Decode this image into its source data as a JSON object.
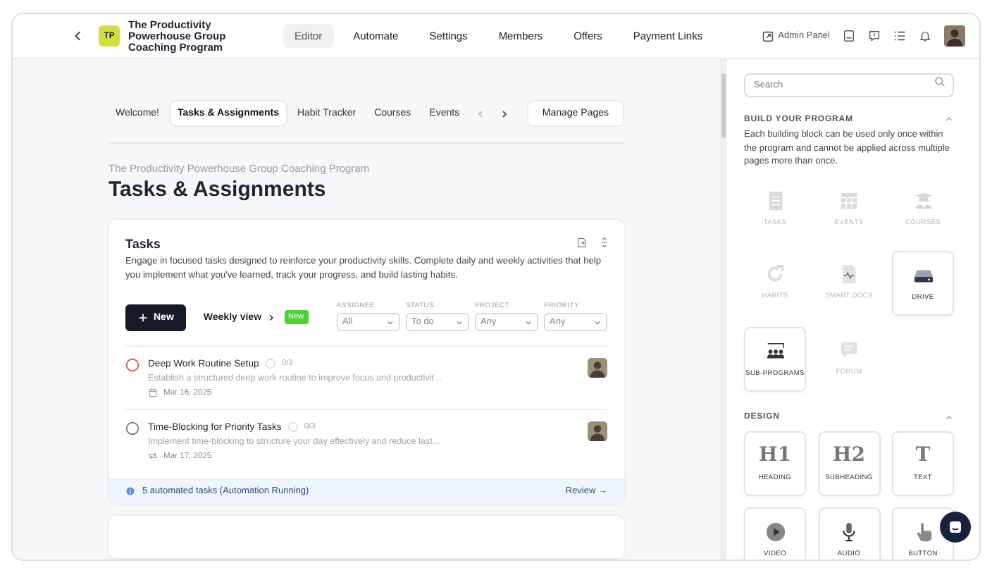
{
  "header": {
    "logo": "TP",
    "program_name": "The Productivity Powerhouse Group Coaching Program",
    "nav": [
      {
        "label": "Editor",
        "selected": true
      },
      {
        "label": "Automate",
        "selected": false
      },
      {
        "label": "Settings",
        "selected": false
      },
      {
        "label": "Members",
        "selected": false
      },
      {
        "label": "Offers",
        "selected": false
      },
      {
        "label": "Payment Links",
        "selected": false
      }
    ],
    "admin_panel": "Admin Panel"
  },
  "page_tabs": [
    {
      "label": "Welcome!",
      "selected": false
    },
    {
      "label": "Tasks & Assignments",
      "selected": true
    },
    {
      "label": "Habit Tracker",
      "selected": false
    },
    {
      "label": "Courses",
      "selected": false
    },
    {
      "label": "Events",
      "selected": false
    }
  ],
  "manage_pages": "Manage Pages",
  "breadcrumb": "The Productivity Powerhouse Group Coaching Program",
  "title": "Tasks & Assignments",
  "tasks_card": {
    "title": "Tasks",
    "description": "Engage in focused tasks designed to reinforce your productivity skills. Complete daily and weekly activities that help you implement what you've learned, track your progress, and build lasting habits.",
    "new_button": "New",
    "weekly_view": "Weekly view",
    "new_badge": "New",
    "filters": [
      {
        "label": "ASSIGNEE",
        "value": "All"
      },
      {
        "label": "STATUS",
        "value": "To do"
      },
      {
        "label": "PROJECT",
        "value": "Any"
      },
      {
        "label": "PRIORITY",
        "value": "Any"
      }
    ],
    "tasks": [
      {
        "title": "Deep Work Routine Setup",
        "progress": "0/3",
        "description": "Establish a structured deep work routine to improve focus and productivit...",
        "date": "Mar 16, 2025",
        "kind": "calendar",
        "color": "#e5484d"
      },
      {
        "title": "Time-Blocking for Priority Tasks",
        "progress": "0/3",
        "description": "Implement time-blocking to structure your day effectively and reduce last...",
        "date": "Mar 17, 2025",
        "kind": "repeat",
        "color": "#6b7280"
      }
    ],
    "automation": {
      "text": "5 automated tasks (Automation Running)",
      "link": "Review →"
    }
  },
  "sidebar": {
    "search_placeholder": "Search",
    "sections": [
      {
        "title": "BUILD YOUR PROGRAM",
        "expanded": true,
        "description": "Each building block can be used only once within the program and cannot be applied across multiple pages more than once.",
        "blocks": [
          {
            "label": "TASKS",
            "kind": "tasks",
            "disabled": true
          },
          {
            "label": "EVENTS",
            "kind": "events",
            "disabled": true
          },
          {
            "label": "COURSES",
            "kind": "courses",
            "disabled": true
          },
          {
            "label": "HABITS",
            "kind": "habits",
            "disabled": true
          },
          {
            "label": "SMART DOCS",
            "kind": "docs",
            "disabled": true
          },
          {
            "label": "DRIVE",
            "kind": "drive",
            "disabled": false
          },
          {
            "label": "SUB-PROGRAMS",
            "kind": "people",
            "disabled": false
          },
          {
            "label": "FORUM",
            "kind": "forum",
            "disabled": true
          }
        ]
      },
      {
        "title": "DESIGN",
        "expanded": true,
        "blocks": [
          {
            "label": "HEADING",
            "kind": "glyph",
            "glyph": "H1",
            "disabled": false
          },
          {
            "label": "SUBHEADING",
            "kind": "glyph",
            "glyph": "H2",
            "disabled": false
          },
          {
            "label": "TEXT",
            "kind": "glyph",
            "glyph": "T",
            "disabled": false
          },
          {
            "label": "VIDEO",
            "kind": "video",
            "disabled": false
          },
          {
            "label": "AUDIO",
            "kind": "audio",
            "disabled": false
          },
          {
            "label": "BUTTON",
            "kind": "hand",
            "disabled": false
          }
        ]
      }
    ]
  }
}
